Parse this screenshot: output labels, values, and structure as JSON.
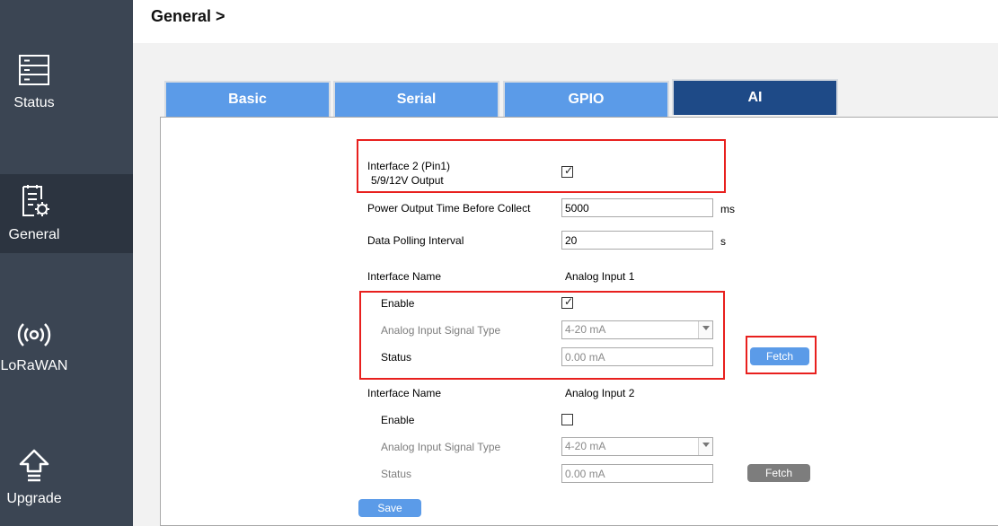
{
  "sidebar": {
    "items": [
      {
        "label": "Status",
        "icon": "server-icon",
        "active": false
      },
      {
        "label": "General",
        "icon": "settings-doc-icon",
        "active": true
      },
      {
        "label": "LoRaWAN",
        "icon": "radio-signal-icon",
        "active": false
      },
      {
        "label": "Upgrade",
        "icon": "upload-arrow-icon",
        "active": false
      }
    ]
  },
  "header": {
    "title": "General >"
  },
  "tabs": [
    {
      "label": "Basic"
    },
    {
      "label": "Serial"
    },
    {
      "label": "GPIO"
    },
    {
      "label": "AI"
    }
  ],
  "active_tab": "AI",
  "form": {
    "interface2": {
      "label_line1": "Interface 2 (Pin1)",
      "label_line2": "5/9/12V Output",
      "checked": true,
      "check_mark": "✓"
    },
    "power_output": {
      "label": "Power Output Time Before Collect",
      "value": "5000",
      "unit": "ms"
    },
    "polling": {
      "label": "Data Polling Interval",
      "value": "20",
      "unit": "s"
    },
    "ai1": {
      "name_label": "Interface Name",
      "name_value": "Analog Input 1",
      "enable_label": "Enable",
      "enable_checked": true,
      "check_mark": "✓",
      "signal_type_label": "Analog Input Signal Type",
      "signal_type_value": "4-20 mA",
      "status_label": "Status",
      "status_value": "0.00 mA",
      "fetch_label": "Fetch"
    },
    "ai2": {
      "name_label": "Interface Name",
      "name_value": "Analog Input 2",
      "enable_label": "Enable",
      "enable_checked": false,
      "signal_type_label": "Analog Input Signal Type",
      "signal_type_value": "4-20 mA",
      "status_label": "Status",
      "status_value": "0.00 mA",
      "fetch_label": "Fetch"
    },
    "save_label": "Save"
  },
  "colors": {
    "sidebar_bg": "#3b4553",
    "tab_blue": "#5b9be8",
    "tab_active": "#1e4a87",
    "highlight_red": "#e8201e"
  }
}
